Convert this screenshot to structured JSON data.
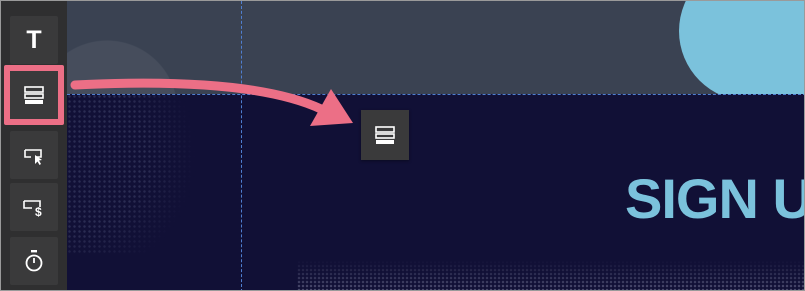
{
  "toolbar": {
    "tools": [
      {
        "id": "text",
        "glyph": "T",
        "icon": "text-icon",
        "state": "normal"
      },
      {
        "id": "section",
        "icon": "section-rows-icon",
        "state": "highlighted"
      },
      {
        "id": "button",
        "icon": "button-click-icon",
        "state": "normal"
      },
      {
        "id": "payment-button",
        "icon": "button-dollar-icon",
        "state": "normal"
      },
      {
        "id": "timer",
        "icon": "stopwatch-icon",
        "state": "normal"
      }
    ]
  },
  "canvas": {
    "headline": "SIGN U",
    "drag_preview_icon": "section-rows-icon",
    "colors": {
      "top_section": "#3a4252",
      "main_section": "#111036",
      "accent": "#7bc2dc",
      "highlight": "#ec6f86",
      "guides": "#4f7fd1"
    }
  },
  "annotation": {
    "arrow": "drag-arrow",
    "color": "#ec6f86"
  }
}
